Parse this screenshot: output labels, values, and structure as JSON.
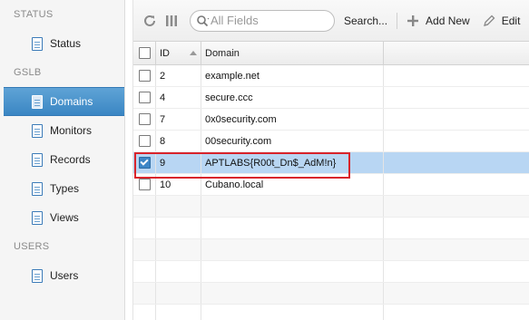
{
  "sidebar": {
    "sections": [
      {
        "header": "STATUS",
        "items": [
          {
            "label": "Status",
            "active": false
          }
        ]
      },
      {
        "header": "GSLB",
        "items": [
          {
            "label": "Domains",
            "active": true
          },
          {
            "label": "Monitors",
            "active": false
          },
          {
            "label": "Records",
            "active": false
          },
          {
            "label": "Types",
            "active": false
          },
          {
            "label": "Views",
            "active": false
          }
        ]
      },
      {
        "header": "USERS",
        "items": [
          {
            "label": "Users",
            "active": false
          }
        ]
      }
    ]
  },
  "toolbar": {
    "search_placeholder": "All Fields",
    "search_label": "Search...",
    "add_new_label": "Add New",
    "edit_label": "Edit"
  },
  "grid": {
    "columns": {
      "id": "ID",
      "domain": "Domain"
    },
    "sort": {
      "column": "ID",
      "direction": "ascending"
    },
    "rows": [
      {
        "id": "2",
        "domain": "example.net",
        "selected": false
      },
      {
        "id": "4",
        "domain": "secure.ccc",
        "selected": false
      },
      {
        "id": "7",
        "domain": "0x0security.com",
        "selected": false
      },
      {
        "id": "8",
        "domain": "00security.com",
        "selected": false
      },
      {
        "id": "9",
        "domain": "APTLABS{R00t_Dn$_AdM!n}",
        "selected": true
      },
      {
        "id": "10",
        "domain": "Cubano.local",
        "selected": false
      }
    ]
  },
  "colors": {
    "selected_row": "#b8d6f3",
    "active_sidebar": "#3a86c3",
    "highlight_border": "#d9242b"
  }
}
